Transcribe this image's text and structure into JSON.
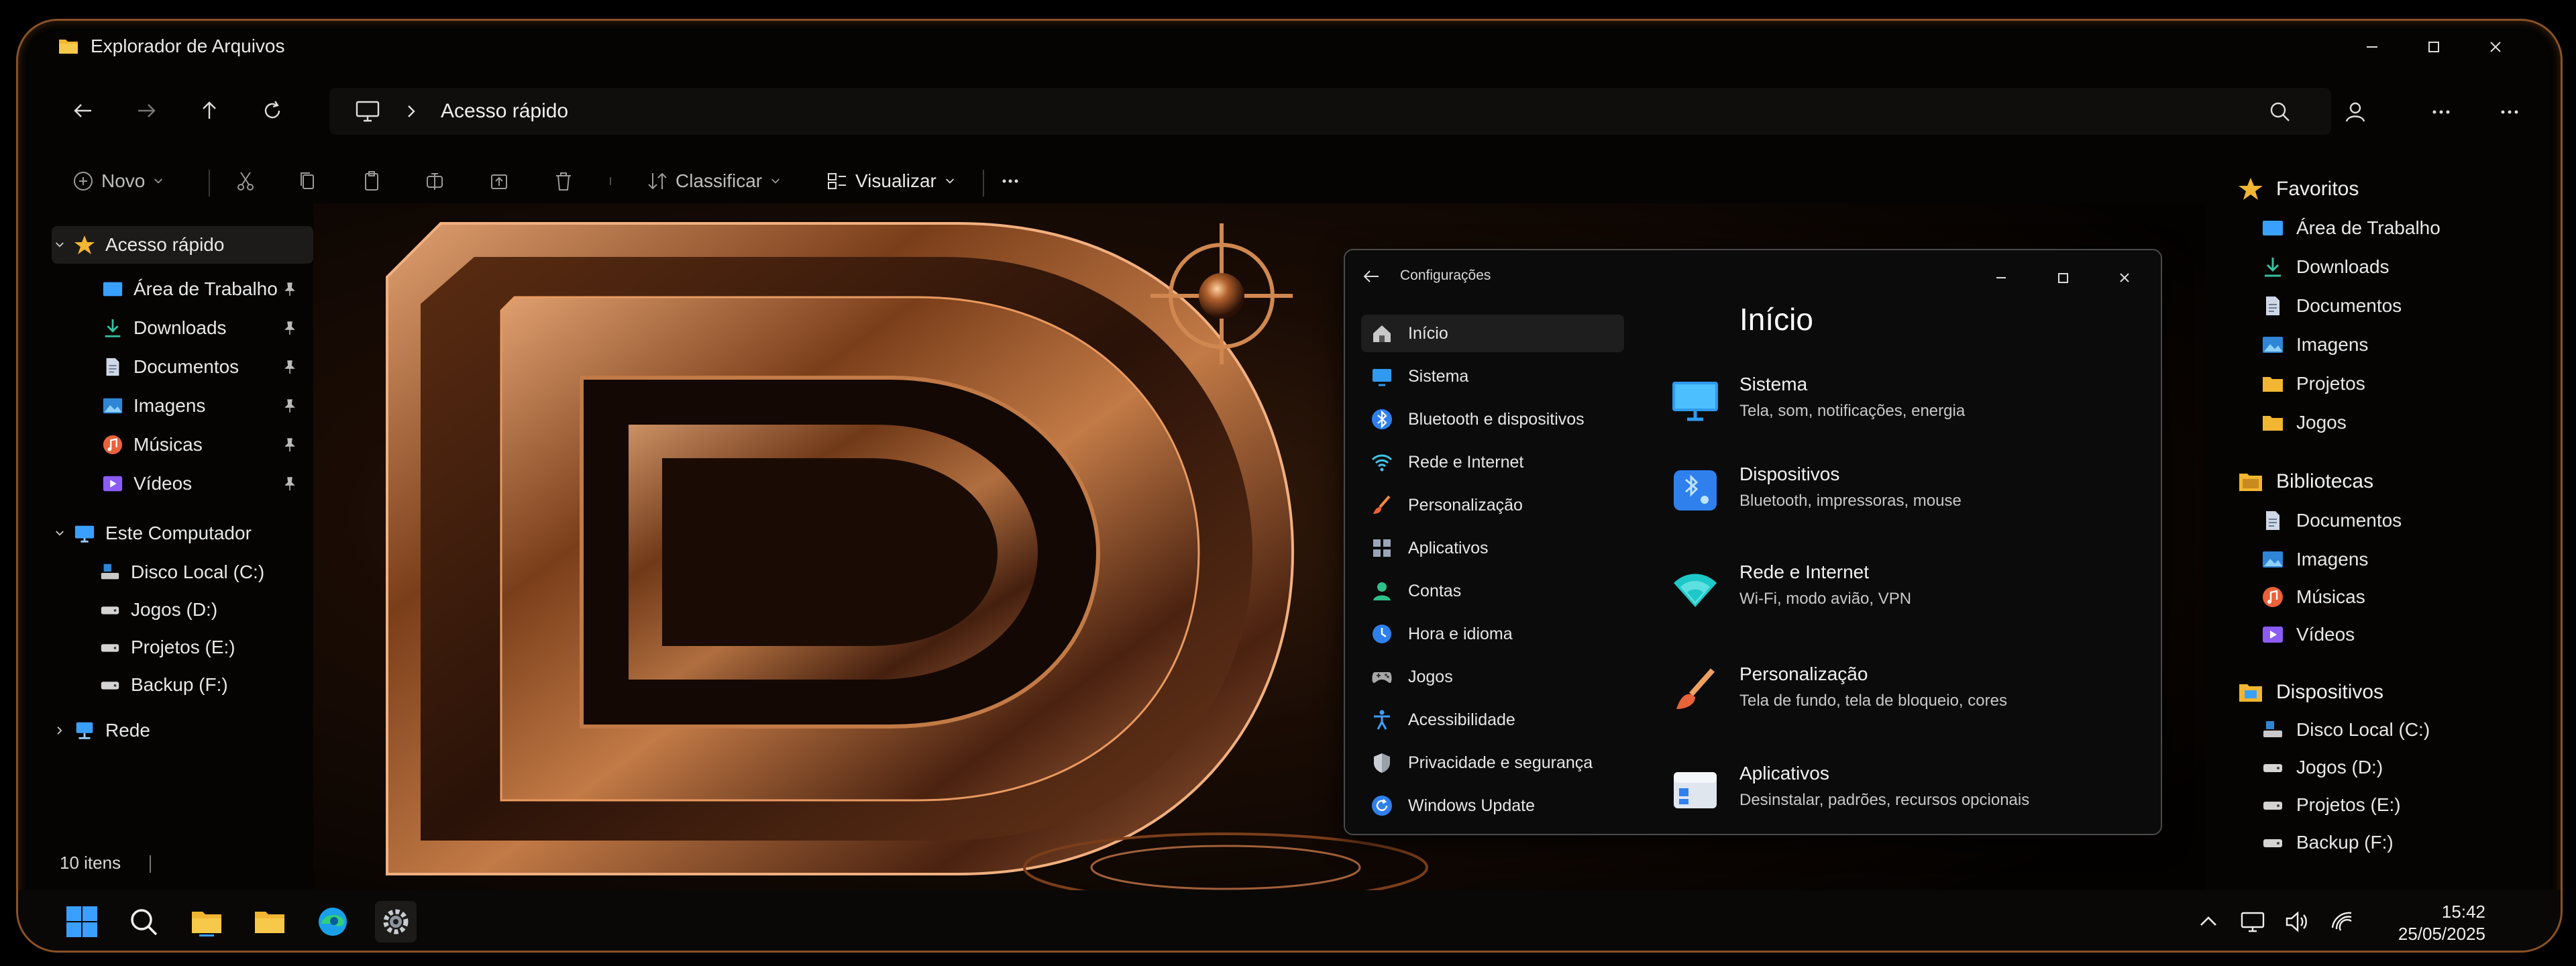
{
  "window": {
    "title": "Explorador de Arquivos"
  },
  "address": {
    "crumb": "Acesso rápido"
  },
  "toolbar": {
    "new_label": "Novo",
    "sort_label": "Classificar",
    "view_label": "Visualizar"
  },
  "sidebar": {
    "quick_access": "Acesso rápido",
    "pinned": [
      {
        "label": "Área de Trabalho",
        "icon": "desktop-icon"
      },
      {
        "label": "Downloads",
        "icon": "download-icon"
      },
      {
        "label": "Documentos",
        "icon": "document-icon"
      },
      {
        "label": "Imagens",
        "icon": "image-icon"
      },
      {
        "label": "Músicas",
        "icon": "music-icon"
      },
      {
        "label": "Vídeos",
        "icon": "video-icon"
      }
    ],
    "this_pc": "Este Computador",
    "drives": [
      {
        "label": "Disco Local (C:)"
      },
      {
        "label": "Jogos (D:)"
      },
      {
        "label": "Projetos (E:)"
      },
      {
        "label": "Backup (F:)"
      }
    ],
    "network": "Rede"
  },
  "status": {
    "count": "10 itens"
  },
  "right_panel": {
    "favorites_title": "Favoritos",
    "favorites": [
      "Área de Trabalho",
      "Downloads",
      "Documentos",
      "Imagens",
      "Projetos",
      "Jogos"
    ],
    "libraries_title": "Bibliotecas",
    "libraries": [
      "Documentos",
      "Imagens",
      "Músicas",
      "Vídeos"
    ],
    "devices_title": "Dispositivos",
    "devices": [
      "Disco Local (C:)",
      "Jogos (D:)",
      "Projetos (E:)",
      "Backup (F:)"
    ]
  },
  "settings": {
    "title": "Configurações",
    "heading": "Início",
    "nav": [
      "Início",
      "Sistema",
      "Bluetooth e dispositivos",
      "Rede e Internet",
      "Personalização",
      "Aplicativos",
      "Contas",
      "Hora e idioma",
      "Jogos",
      "Acessibilidade",
      "Privacidade e segurança",
      "Windows Update"
    ],
    "cards": [
      {
        "title": "Sistema",
        "desc": "Tela, som, notificações, energia"
      },
      {
        "title": "Dispositivos",
        "desc": "Bluetooth, impressoras, mouse"
      },
      {
        "title": "Rede e Internet",
        "desc": "Wi-Fi, modo avião, VPN"
      },
      {
        "title": "Personalização",
        "desc": "Tela de fundo, tela de bloqueio, cores"
      },
      {
        "title": "Aplicativos",
        "desc": "Desinstalar, padrões, recursos opcionais"
      }
    ]
  },
  "taskbar": {
    "time": "15:42",
    "date": "25/05/2025"
  },
  "colors": {
    "accent": "#8a5226",
    "folder": "#f2b632",
    "blue": "#3aa0ff"
  }
}
